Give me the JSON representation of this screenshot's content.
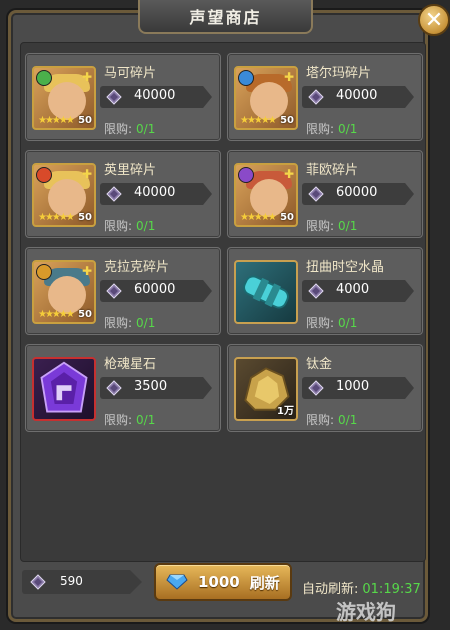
{
  "shop": {
    "title": "声望商店",
    "close_glyph": "✕",
    "currency_icon": "reputation-icon",
    "limit_label": "限购:",
    "items": [
      {
        "name": "马可碎片",
        "price": "40000",
        "limit": "0/1",
        "level": "50",
        "stars": "★★★★★",
        "element_color": "#4bb04b"
      },
      {
        "name": "塔尔玛碎片",
        "price": "40000",
        "limit": "0/1",
        "level": "50",
        "stars": "★★★★★",
        "element_color": "#3a8ad8"
      },
      {
        "name": "英里碎片",
        "price": "40000",
        "limit": "0/1",
        "level": "50",
        "stars": "★★★★★",
        "element_color": "#d84a2a"
      },
      {
        "name": "菲欧碎片",
        "price": "60000",
        "limit": "0/1",
        "level": "50",
        "stars": "★★★★★",
        "element_color": "#8a4ac8"
      },
      {
        "name": "克拉克碎片",
        "price": "60000",
        "limit": "0/1",
        "level": "50",
        "stars": "★★★★★",
        "element_color": "#d89a2a"
      },
      {
        "name": "扭曲时空水晶",
        "price": "4000",
        "limit": "0/1"
      },
      {
        "name": "枪魂星石",
        "price": "3500",
        "limit": "0/1"
      },
      {
        "name": "钛金",
        "price": "1000",
        "limit": "0/1",
        "badge": "1万"
      }
    ]
  },
  "footer": {
    "reputation_amount": "590",
    "refresh_cost": "1000",
    "refresh_label": "刷新",
    "auto_refresh_label": "自动刷新:",
    "auto_refresh_time": "01:19:37",
    "watermark": "游戏狗"
  },
  "colors": {
    "limit_value": "#57d84a",
    "accent_gold": "#c8943a"
  }
}
